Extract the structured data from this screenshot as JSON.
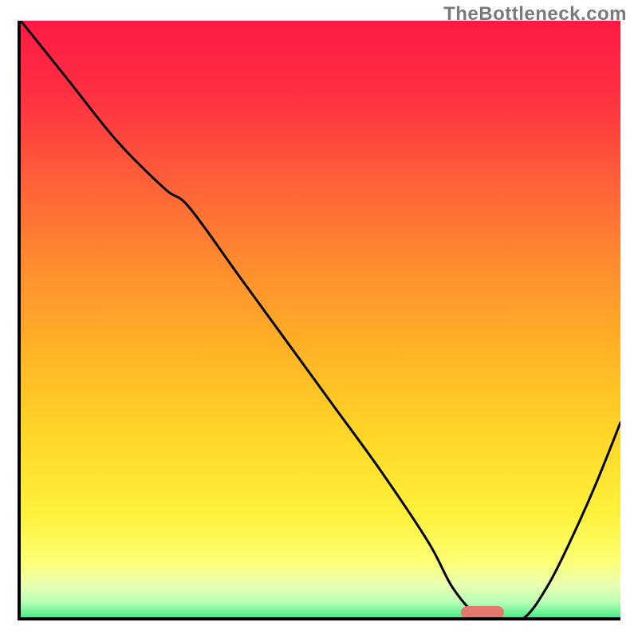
{
  "watermark": "TheBottleneck.com",
  "colors": {
    "gradient_top": "#ff1a44",
    "gradient_bottom": "#2fe97d",
    "curve": "#000000",
    "marker": "#e4776f",
    "axis": "#000000"
  },
  "chart_data": {
    "type": "line",
    "title": "",
    "xlabel": "",
    "ylabel": "",
    "xlim": [
      0,
      1000
    ],
    "ylim": [
      0,
      1000
    ],
    "grid": false,
    "legend": false,
    "series": [
      {
        "name": "bottleneck-curve",
        "x": [
          0,
          80,
          160,
          240,
          280,
          360,
          440,
          520,
          600,
          680,
          720,
          760,
          800,
          840,
          880,
          920,
          960,
          1000
        ],
        "y": [
          1000,
          900,
          800,
          720,
          690,
          580,
          470,
          360,
          250,
          130,
          55,
          10,
          2,
          5,
          60,
          140,
          230,
          330
        ]
      }
    ],
    "optimum_marker": {
      "x": 770,
      "y": 8
    },
    "note": "y represents value height (0 = bottom axis, 1000 = top). Colors encode y: red≈high, green≈low."
  }
}
